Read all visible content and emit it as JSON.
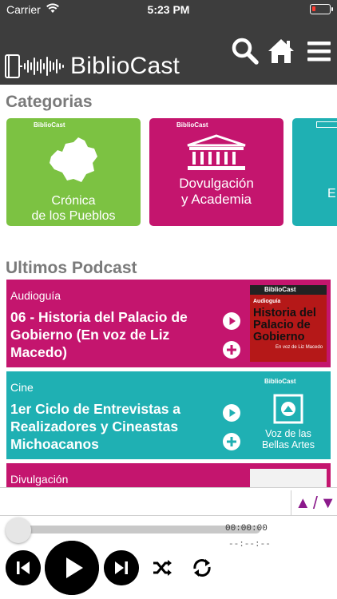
{
  "status": {
    "carrier": "Carrier",
    "time": "5:23 PM"
  },
  "header": {
    "app_name": "BiblioCast"
  },
  "sections": {
    "categories": "Categorias",
    "latest": "Ultimos Podcast"
  },
  "categories": [
    {
      "label": "Crónica de los Pueblos",
      "line1": "Crónica",
      "line2": "de los Pueblos",
      "color": "#7cc242",
      "brand": "BiblioCast"
    },
    {
      "label": "Dovulgación y Academia",
      "line1": "Dovulgación",
      "line2": "y Academia",
      "color": "#c4156e",
      "brand": "BiblioCast"
    },
    {
      "label": "E",
      "line1": "E",
      "line2": "",
      "color": "#1fb0b3"
    }
  ],
  "podcasts": [
    {
      "category": "Audioguía",
      "title": "06 - Historia del Palacio de Gobierno (En voz de Liz Macedo)",
      "color": "#c4156e",
      "thumb_heading": "Audioguía",
      "thumb_lines": [
        "Historia del",
        "Palacio de",
        "Gobierno"
      ],
      "thumb_caption": "En voz de Liz Macedo",
      "brand": "BiblioCast"
    },
    {
      "category": "Cine",
      "title": "1er Ciclo de Entrevistas a Realizadores y Cineastas Michoacanos",
      "color": "#1fb0b3",
      "thumb_lines": [
        "Voz de las",
        "Bellas Artes"
      ],
      "brand": "BiblioCast"
    },
    {
      "category": "Divulgación",
      "title": "",
      "color": "#c4156e"
    }
  ],
  "player": {
    "elapsed": "00:00:00",
    "duration": "--:--:--",
    "progress": 0
  },
  "colors": {
    "header": "#3d3d3d",
    "accent": "#8b1a8b"
  },
  "icons": [
    "wifi-icon",
    "battery-icon",
    "search-icon",
    "home-icon",
    "menu-icon",
    "play-icon",
    "add-icon",
    "previous-icon",
    "next-icon",
    "shuffle-icon",
    "repeat-icon",
    "arrow-up-icon",
    "arrow-down-icon"
  ]
}
